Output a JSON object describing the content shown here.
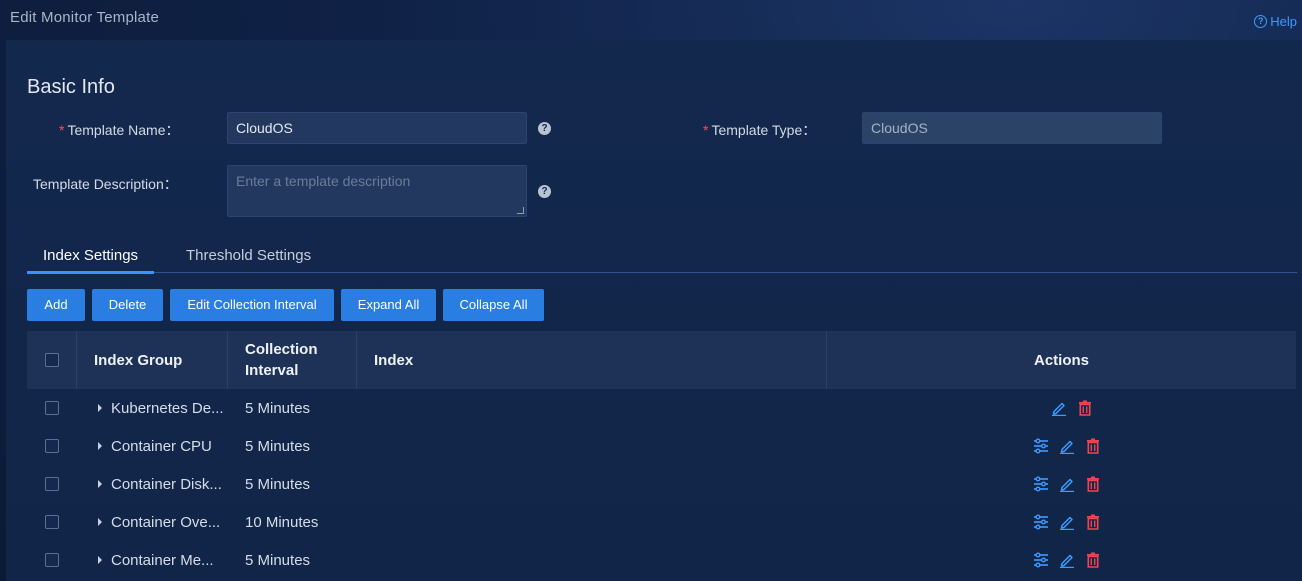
{
  "window": {
    "title": "Edit Monitor Template",
    "help_label": "Help"
  },
  "basic_info": {
    "title": "Basic Info",
    "template_name": {
      "label": "Template Name：",
      "value": "CloudOS"
    },
    "template_type": {
      "label": "Template Type：",
      "value": "CloudOS"
    },
    "template_description": {
      "label": "Template Description：",
      "placeholder": "Enter a template description"
    }
  },
  "tabs": [
    {
      "label": "Index Settings",
      "active": true
    },
    {
      "label": "Threshold Settings",
      "active": false
    }
  ],
  "toolbar": {
    "add": "Add",
    "delete": "Delete",
    "edit_interval": "Edit Collection Interval",
    "expand_all": "Expand All",
    "collapse_all": "Collapse All"
  },
  "table": {
    "headers": {
      "index_group": "Index Group",
      "collection_interval_1": "Collection",
      "collection_interval_2": "Interval",
      "index": "Index",
      "actions": "Actions"
    },
    "rows": [
      {
        "group": "Kubernetes De...",
        "interval": "5 Minutes",
        "index": "",
        "actions": [
          "edit-icon",
          "delete-icon"
        ]
      },
      {
        "group": "Container CPU",
        "interval": "5 Minutes",
        "index": "",
        "actions": [
          "settings-icon",
          "edit-icon",
          "delete-icon"
        ]
      },
      {
        "group": "Container Disk...",
        "interval": "5 Minutes",
        "index": "",
        "actions": [
          "settings-icon",
          "edit-icon",
          "delete-icon"
        ]
      },
      {
        "group": "Container Ove...",
        "interval": "10 Minutes",
        "index": "",
        "actions": [
          "settings-icon",
          "edit-icon",
          "delete-icon"
        ]
      },
      {
        "group": "Container Me...",
        "interval": "5 Minutes",
        "index": "",
        "actions": [
          "settings-icon",
          "edit-icon",
          "delete-icon"
        ]
      }
    ]
  },
  "colors": {
    "primary": "#2a7de1",
    "link_icon": "#3f9bff",
    "danger_icon": "#f0454f",
    "required": "#ff4d4f"
  }
}
